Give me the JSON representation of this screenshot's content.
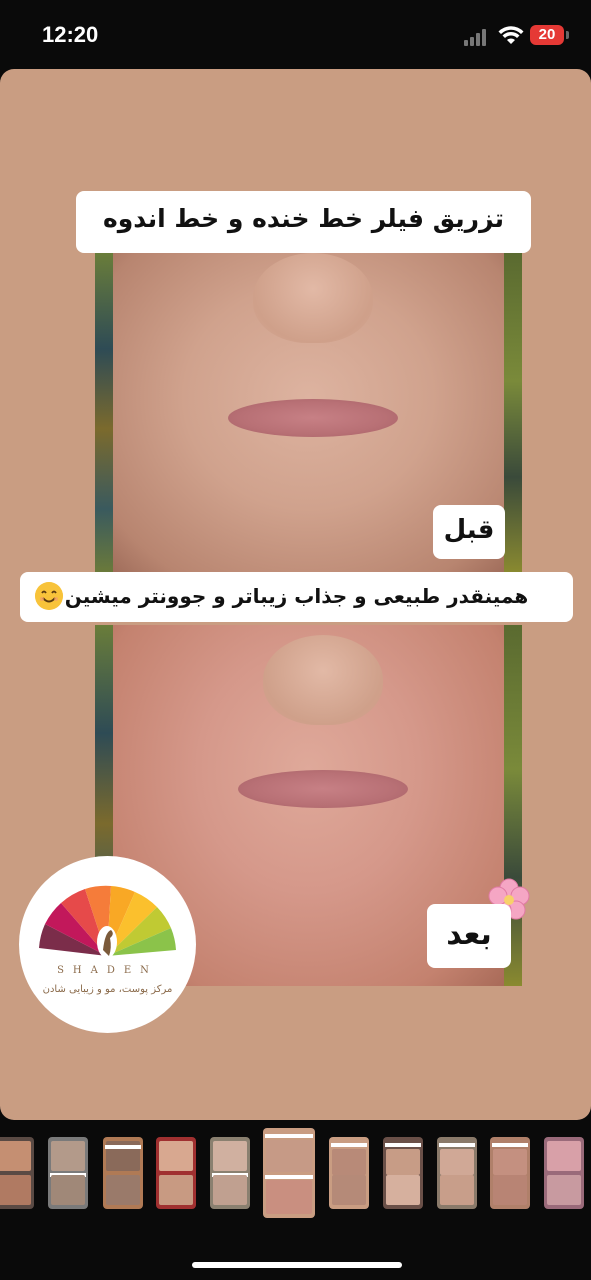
{
  "status_bar": {
    "time": "12:20",
    "battery_level": "20",
    "battery_color": "#e53935"
  },
  "post": {
    "background_color": "#c99d82",
    "title": "تزریق فیلر خط خنده و خط اندوه",
    "before_label": "قبل",
    "after_label": "بعد",
    "caption": "همینقدر طبیعی و جذاب زیباتر و جوونتر میشین",
    "caption_emoji": "smiling-face-emoji",
    "flower_emoji": "cherry-blossom-emoji",
    "logo": {
      "brand": "SHADEN",
      "subtitle": "مرکز پوست، مو و زیبایی شادن"
    }
  },
  "thumbnails": {
    "count": 11,
    "active_index": 5
  }
}
